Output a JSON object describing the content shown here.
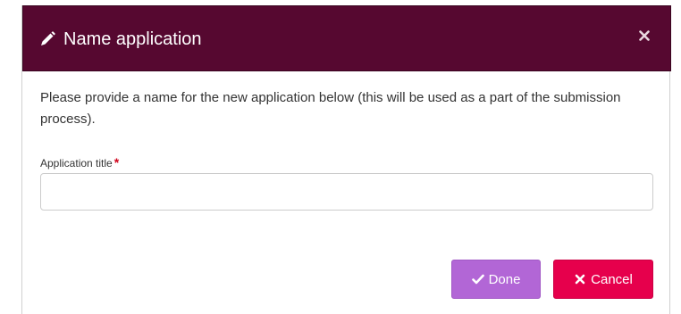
{
  "dialog": {
    "title": "Name application",
    "description": "Please provide a name for the new application below (this will be used as a part of the submission process).",
    "field": {
      "label": "Application title",
      "required_marker": "*",
      "value": "",
      "placeholder": ""
    },
    "buttons": {
      "done_label": "Done",
      "cancel_label": "Cancel"
    },
    "icons": {
      "title": "pencil-icon",
      "close": "close-icon",
      "done": "check-icon",
      "cancel": "close-icon"
    },
    "colors": {
      "header": "#560830",
      "done": "#b266d6",
      "cancel": "#e6004c",
      "required": "#d0021b"
    }
  }
}
